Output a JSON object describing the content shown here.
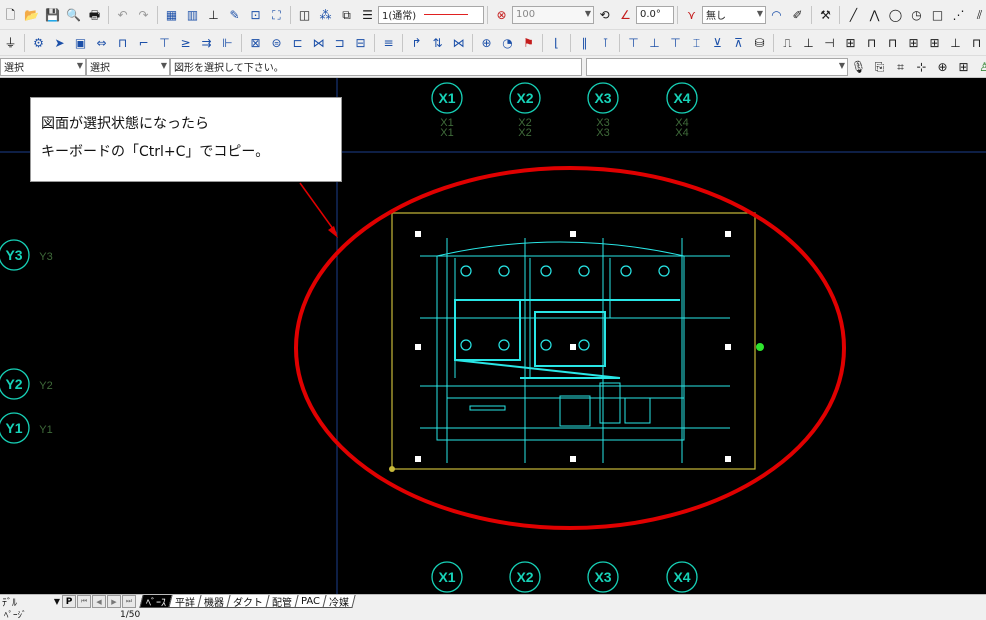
{
  "toolbar1": {
    "linetype_label": "1(通常)",
    "transparency_value": "100",
    "angle_value": "0.0°",
    "pattern_label": "無し"
  },
  "toolbar3": {
    "mode1": "選択",
    "mode2": "選択",
    "hint": "図形を選択して下さい。"
  },
  "callout": {
    "line1": "図面が選択状態になったら",
    "line2": "キーボードの「Ctrl+C」でコピー。"
  },
  "drawing": {
    "grid_top": [
      "X1",
      "X2",
      "X3",
      "X4"
    ],
    "grid_bottom": [
      "X1",
      "X2",
      "X3",
      "X4"
    ],
    "grid_left": [
      "Y3",
      "Y2",
      "Y1"
    ],
    "colors": {
      "background": "#000000",
      "grid": "#17d2b8",
      "selection": "#c7b93a",
      "annotation": "#e00000",
      "drawing": "#29e6e6"
    }
  },
  "statusbar": {
    "layer": "ﾃﾞﾙ",
    "page_button": "P",
    "tabs": [
      "ﾍﾞｰｽ",
      "平詳",
      "機器",
      "ダクト",
      "配管",
      "PAC",
      "冷媒"
    ],
    "active_tab": "ﾍﾞｰｽ",
    "page_label": "ﾍﾟｰｼﾞ",
    "page_number": "1/50"
  }
}
